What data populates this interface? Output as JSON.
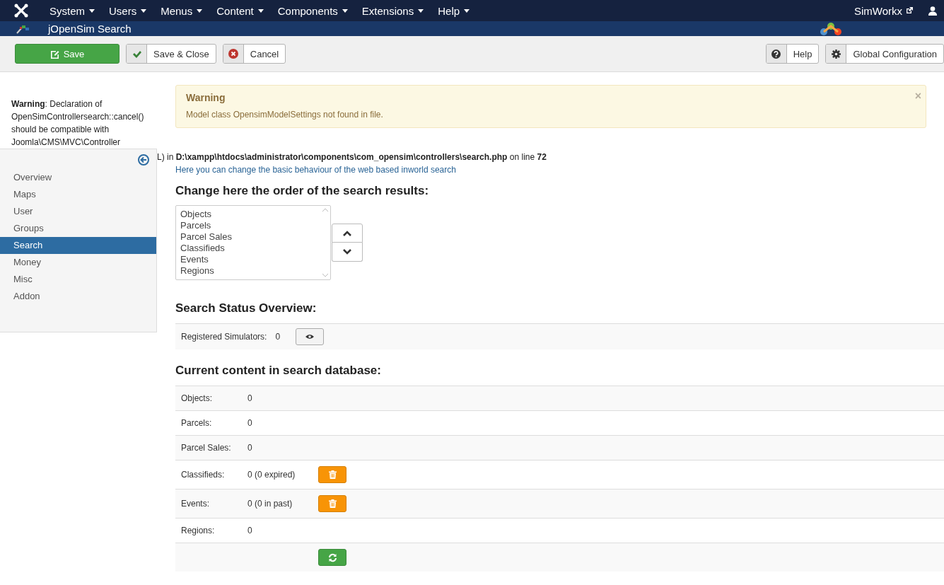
{
  "navbar": {
    "menus": [
      {
        "label": "System"
      },
      {
        "label": "Users"
      },
      {
        "label": "Menus"
      },
      {
        "label": "Content"
      },
      {
        "label": "Components"
      },
      {
        "label": "Extensions"
      },
      {
        "label": "Help"
      }
    ],
    "user_link": "SimWorkx"
  },
  "header": {
    "title": "jOpenSim Search"
  },
  "toolbar": {
    "buttons": [
      {
        "label": "Save",
        "kind": "save"
      },
      {
        "label": "Save & Close",
        "kind": "save-close"
      },
      {
        "label": "Cancel",
        "kind": "cancel"
      }
    ],
    "right_buttons": [
      {
        "label": "Help",
        "kind": "help"
      },
      {
        "label": "Global Configuration",
        "kind": "options"
      }
    ]
  },
  "php_warning": {
    "text": "**Warning**: Declaration of OpenSimControllersearch::cancel() should be compatible with Joomla\\CMS\\MVC\\Controller",
    "continuation": "L) in **D:\\xampp\\htdocs\\administrator\\components\\com_opensim\\controllers\\search.php** on line **72**"
  },
  "sidebar": {
    "items": [
      {
        "label": "Overview",
        "selected": false
      },
      {
        "label": "Maps",
        "selected": false
      },
      {
        "label": "User",
        "selected": false
      },
      {
        "label": "Groups",
        "selected": false
      },
      {
        "label": "Search",
        "selected": true
      },
      {
        "label": "Money",
        "selected": false
      },
      {
        "label": "Misc",
        "selected": false
      },
      {
        "label": "Addon",
        "selected": false
      }
    ]
  },
  "alert": {
    "title": "Warning",
    "message": "Model class OpensimModelSettings not found in file.",
    "close": "×"
  },
  "description": "Here you can change the basic behaviour of the web based inworld search",
  "order_section": {
    "heading": "Change here the order of the search results:",
    "items": [
      "Objects",
      "Parcels",
      "Parcel Sales",
      "Classifieds",
      "Events",
      "Regions"
    ]
  },
  "status_section": {
    "heading": "Search Status Overview:",
    "label": "Registered Simulators:",
    "value": "0"
  },
  "content_section": {
    "heading": "Current content in search database:",
    "rows": [
      {
        "label": "Objects:",
        "value": "0",
        "kind": "plain"
      },
      {
        "label": "Parcels:",
        "value": "0",
        "kind": "plain"
      },
      {
        "label": "Parcel Sales:",
        "value": "0",
        "kind": "plain"
      },
      {
        "label": "Classifieds:",
        "value": "0 (0 expired)",
        "kind": "delete"
      },
      {
        "label": "Events:",
        "value": "0 (0 in past)",
        "kind": "delete"
      },
      {
        "label": "Regions:",
        "value": "0",
        "kind": "plain"
      }
    ],
    "footer": {
      "kind": "refresh"
    }
  }
}
